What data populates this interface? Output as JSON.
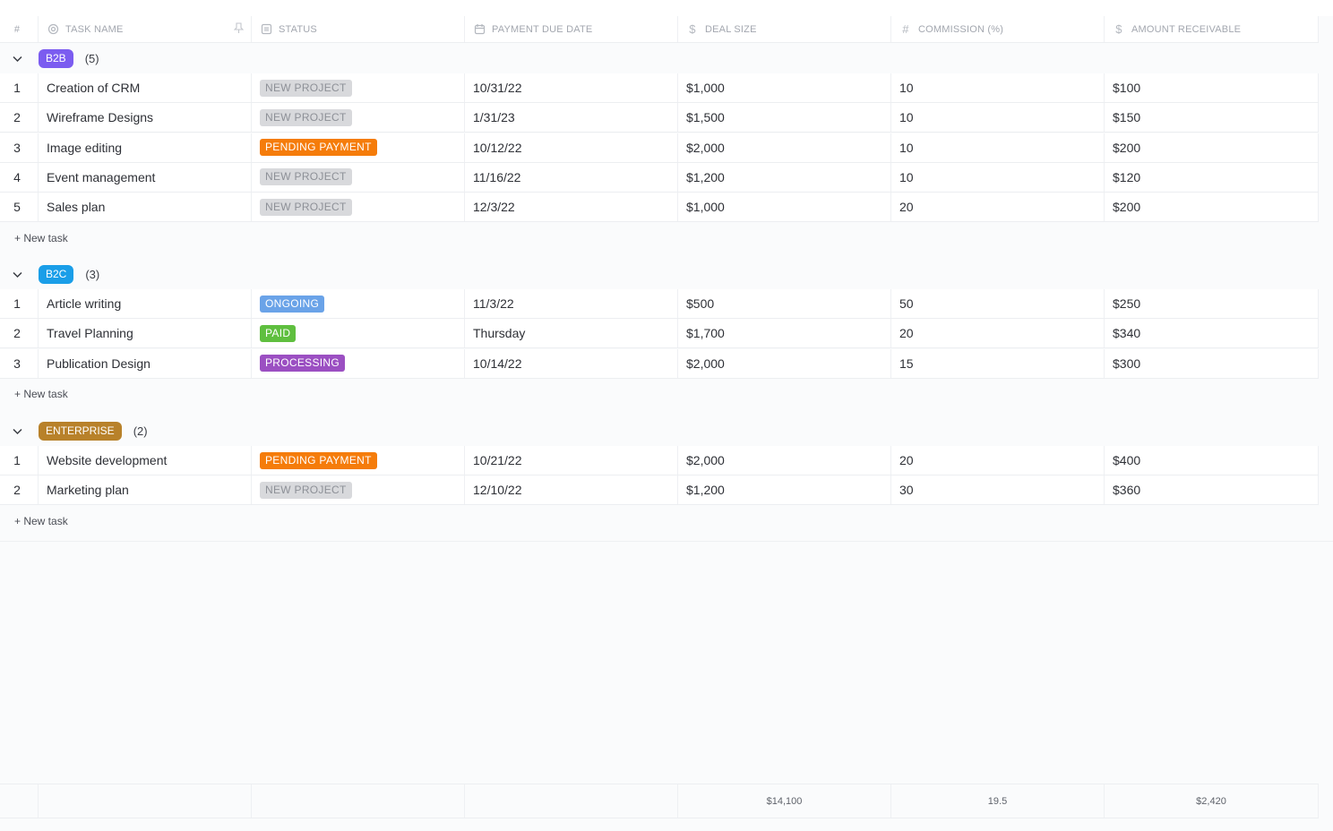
{
  "columns": {
    "num": "#",
    "task_name": "TASK NAME",
    "status": "STATUS",
    "payment_due_date": "PAYMENT DUE DATE",
    "deal_size": "DEAL SIZE",
    "commission": "COMMISSION (%)",
    "amount_receivable": "AMOUNT RECEIVABLE"
  },
  "new_task_label": "+ New task",
  "status_colors": {
    "NEW PROJECT": {
      "bg": "#d8d9dc",
      "fg": "#8d9097"
    },
    "PENDING PAYMENT": {
      "bg": "#f57c0a",
      "fg": "#ffffff"
    },
    "ONGOING": {
      "bg": "#6aa3e8",
      "fg": "#ffffff"
    },
    "PAID": {
      "bg": "#5fbf3f",
      "fg": "#ffffff"
    },
    "PROCESSING": {
      "bg": "#9b4fc2",
      "fg": "#ffffff"
    }
  },
  "groups": [
    {
      "label": "B2B",
      "count": "(5)",
      "color": "#7b5cf0",
      "rows": [
        {
          "num": "1",
          "name": "Creation of CRM",
          "status": "NEW PROJECT",
          "date": "10/31/22",
          "deal": "$1,000",
          "commission": "10",
          "amount": "$100"
        },
        {
          "num": "2",
          "name": "Wireframe Designs",
          "status": "NEW PROJECT",
          "date": "1/31/23",
          "deal": "$1,500",
          "commission": "10",
          "amount": "$150"
        },
        {
          "num": "3",
          "name": "Image editing",
          "status": "PENDING PAYMENT",
          "date": "10/12/22",
          "deal": "$2,000",
          "commission": "10",
          "amount": "$200"
        },
        {
          "num": "4",
          "name": "Event management",
          "status": "NEW PROJECT",
          "date": "11/16/22",
          "deal": "$1,200",
          "commission": "10",
          "amount": "$120"
        },
        {
          "num": "5",
          "name": "Sales plan",
          "status": "NEW PROJECT",
          "date": "12/3/22",
          "deal": "$1,000",
          "commission": "20",
          "amount": "$200"
        }
      ]
    },
    {
      "label": "B2C",
      "count": "(3)",
      "color": "#1a9ee8",
      "rows": [
        {
          "num": "1",
          "name": "Article writing",
          "status": "ONGOING",
          "date": "11/3/22",
          "deal": "$500",
          "commission": "50",
          "amount": "$250"
        },
        {
          "num": "2",
          "name": "Travel Planning",
          "status": "PAID",
          "date": "Thursday",
          "deal": "$1,700",
          "commission": "20",
          "amount": "$340"
        },
        {
          "num": "3",
          "name": "Publication Design",
          "status": "PROCESSING",
          "date": "10/14/22",
          "deal": "$2,000",
          "commission": "15",
          "amount": "$300"
        }
      ]
    },
    {
      "label": "ENTERPRISE",
      "count": "(2)",
      "color": "#b8812a",
      "rows": [
        {
          "num": "1",
          "name": "Website development",
          "status": "PENDING PAYMENT",
          "date": "10/21/22",
          "deal": "$2,000",
          "commission": "20",
          "amount": "$400"
        },
        {
          "num": "2",
          "name": "Marketing plan",
          "status": "NEW PROJECT",
          "date": "12/10/22",
          "deal": "$1,200",
          "commission": "30",
          "amount": "$360"
        }
      ]
    }
  ],
  "totals": {
    "deal": "$14,100",
    "commission": "19.5",
    "amount": "$2,420"
  }
}
